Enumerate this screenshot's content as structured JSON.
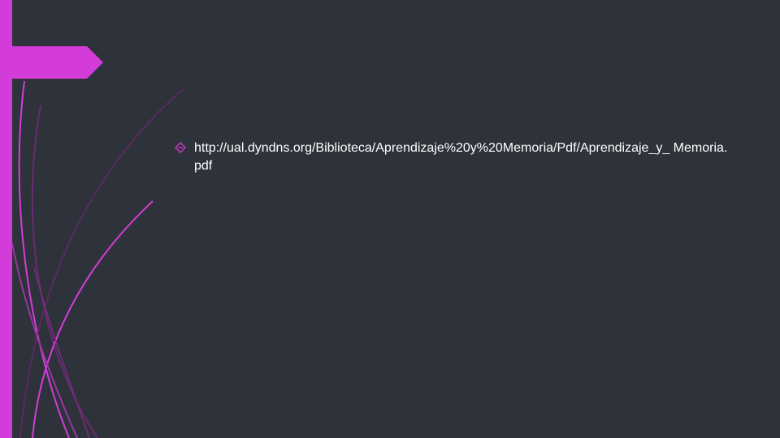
{
  "slide": {
    "link_text": "http://ual.dyndns.org/Biblioteca/Aprendizaje%20y%20Memoria/Pdf/Aprendizaje_y_ Memoria.pdf",
    "bullet_icon": "diamond-arrow-bullet-icon"
  },
  "colors": {
    "background": "#2e323a",
    "accent": "#d43cd9",
    "text": "#ffffff"
  }
}
